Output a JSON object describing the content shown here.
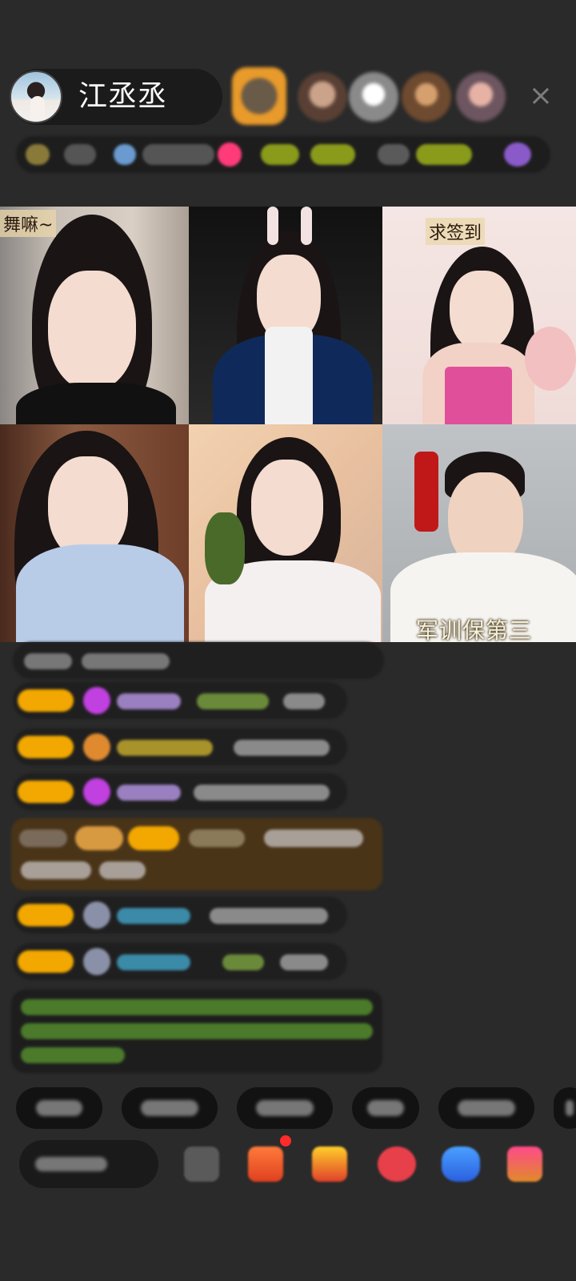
{
  "header": {
    "host_name": "江丞丞",
    "close_label": "×"
  },
  "grid": {
    "tiles": [
      {
        "label": "舞嘛~"
      },
      {
        "label": ""
      },
      {
        "label": "求签到"
      },
      {
        "label": ""
      },
      {
        "label": ""
      },
      {
        "label": "军训保第三"
      }
    ]
  },
  "colors": {
    "background": "#2a2a2a",
    "badge": "#f2a800",
    "accent_pink": "#ff3b7a"
  }
}
